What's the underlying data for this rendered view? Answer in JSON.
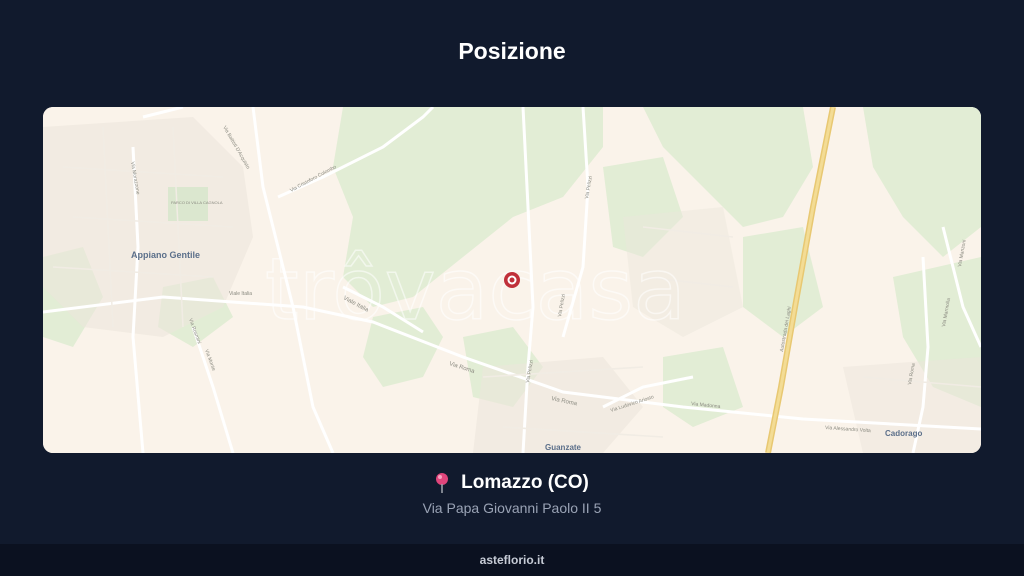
{
  "page": {
    "title": "Posizione"
  },
  "map": {
    "watermark": "trôvacasa",
    "places": {
      "appiano": "Appiano Gentile",
      "guanzate": "Guanzate",
      "cadorago": "Cadorago"
    },
    "streets": {
      "viale_italia_1": "Viale Italia",
      "viale_italia_2": "Viale Italia",
      "via_roma_1": "Via Roma",
      "via_roma_2": "Via Roma",
      "via_roma_3": "Via Roma",
      "via_cristoforo_colombo": "Via Cristoforo Colombo",
      "via_battisti": "Via Battisti D'Acquisto",
      "via_pelizzi_1": "Via Pelizzi",
      "via_pelizzi_2": "Via Pelizzi",
      "via_pelizzi_3": "Via Pelizzi",
      "via_madonna": "Via Madonna",
      "via_ludovico": "Via Ludovico Ariosto",
      "via_alessandro_volta": "Via Alessandro Volta",
      "autostrada": "Autostrada dei Laghi",
      "via_marmolla": "Via Marmolla",
      "via_manzoni": "Via Manzoni",
      "via_morazzone": "Via Morazzone",
      "via_rosmini": "Via Rosmini",
      "via_monte": "Via Monte",
      "parco": "PARCO DI VILLA CAGNOLA"
    },
    "marker_color": "#c0303a"
  },
  "location": {
    "pin_icon": "map-pin-icon",
    "city": "Lomazzo (CO)",
    "address": "Via Papa Giovanni Paolo II 5"
  },
  "footer": {
    "site": "asteflorio.it"
  }
}
